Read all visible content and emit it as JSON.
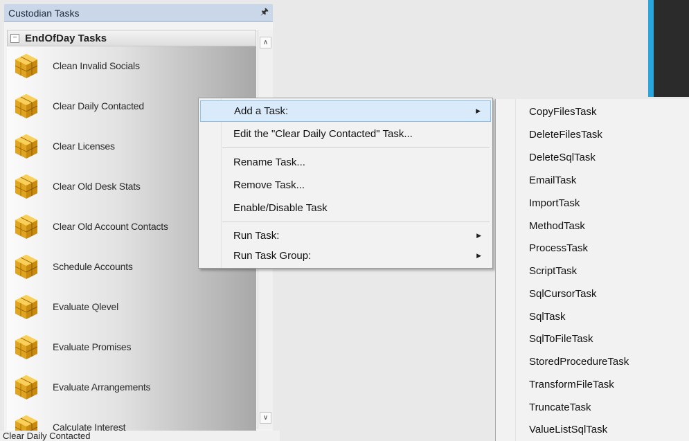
{
  "panel": {
    "title": "Custodian Tasks",
    "pin_icon": "pin-icon",
    "group": {
      "label": "EndOfDay Tasks",
      "collapse_symbol": "−"
    },
    "tasks": [
      {
        "label": "Clean Invalid Socials"
      },
      {
        "label": "Clear Daily Contacted"
      },
      {
        "label": "Clear Licenses"
      },
      {
        "label": "Clear Old Desk Stats"
      },
      {
        "label": "Clear Old Account Contacts"
      },
      {
        "label": "Schedule Accounts"
      },
      {
        "label": "Evaluate Qlevel"
      },
      {
        "label": "Evaluate Promises"
      },
      {
        "label": "Evaluate Arrangements"
      },
      {
        "label": "Calculate Interest"
      }
    ],
    "status_text": "Clear Daily Contacted"
  },
  "context_menu": {
    "items": [
      {
        "label": "Add a Task:",
        "has_submenu": true,
        "highlighted": true
      },
      {
        "label": "Edit the \"Clear Daily Contacted\" Task...",
        "has_submenu": false
      },
      {
        "label": "Rename Task...",
        "has_submenu": false
      },
      {
        "label": "Remove Task...",
        "has_submenu": false
      },
      {
        "label": "Enable/Disable Task",
        "has_submenu": false
      },
      {
        "label": "Run Task:",
        "has_submenu": true
      },
      {
        "label": "Run Task Group:",
        "has_submenu": true
      }
    ]
  },
  "submenu": {
    "items": [
      "CopyFilesTask",
      "DeleteFilesTask",
      "DeleteSqlTask",
      "EmailTask",
      "ImportTask",
      "MethodTask",
      "ProcessTask",
      "ScriptTask",
      "SqlCursorTask",
      "SqlTask",
      "SqlToFileTask",
      "StoredProcedureTask",
      "TransformFileTask",
      "TruncateTask",
      "ValueListSqlTask"
    ]
  },
  "colors": {
    "accent_blue": "#2aa6df",
    "menu_highlight": "#d9ebfa",
    "header_bg": "#c9d7e8"
  }
}
